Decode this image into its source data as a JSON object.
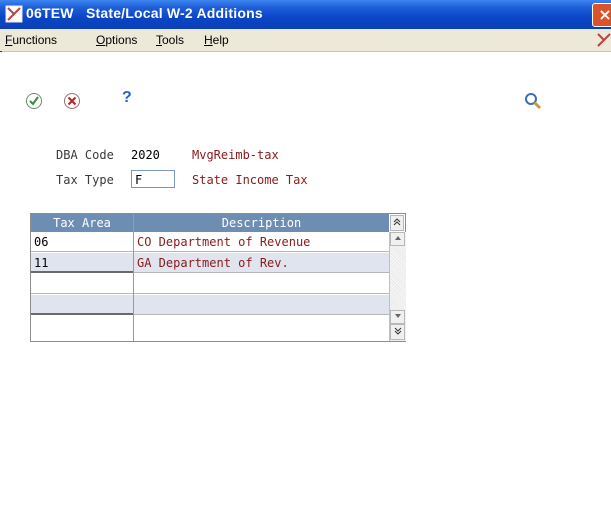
{
  "window": {
    "title": "06TEW   State/Local W-2 Additions",
    "close_label": "×"
  },
  "menu": {
    "items": [
      "Functions",
      "Options",
      "Tools",
      "Help"
    ]
  },
  "toolbar": {
    "ok_icon": "checkmark-icon",
    "cancel_icon": "cancel-icon",
    "help_label": "?",
    "search_icon": "search-icon"
  },
  "form": {
    "dba_code_label": "DBA Code",
    "dba_code_value": "2020",
    "dba_code_desc": "MvgReimb-tax",
    "tax_type_label": "Tax Type",
    "tax_type_value": "F",
    "tax_type_desc": "State Income Tax"
  },
  "grid": {
    "headers": [
      "Tax Area",
      "Description"
    ],
    "rows": [
      {
        "tax_area": "06",
        "description": "CO Department of Revenue"
      },
      {
        "tax_area": "11",
        "description": "GA Department of Rev."
      },
      {
        "tax_area": "",
        "description": ""
      },
      {
        "tax_area": "",
        "description": ""
      },
      {
        "tax_area": "",
        "description": ""
      }
    ]
  },
  "colors": {
    "title_bar": "#0b3fb3",
    "grid_header": "#6e8db3",
    "desc_text": "#8a1a1a",
    "alt_row": "#dfe4ee"
  }
}
